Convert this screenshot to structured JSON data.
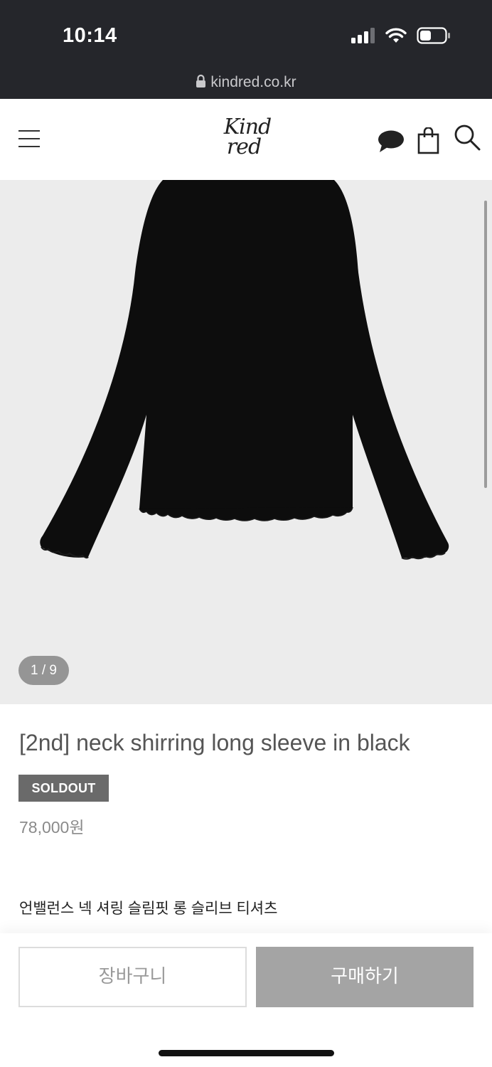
{
  "status_bar": {
    "time": "10:14",
    "icons": [
      "signal-icon",
      "wifi-icon",
      "battery-icon"
    ],
    "url": "kindred.co.kr"
  },
  "header": {
    "logo_line1": "Kind",
    "logo_line2": "red",
    "icons": [
      "menu-icon",
      "chat-icon",
      "shopping-bag-icon",
      "search-icon"
    ]
  },
  "gallery": {
    "counter": "1 / 9",
    "background": "#ececec",
    "garment_color": "#0d0d0d"
  },
  "product": {
    "title": "[2nd] neck shirring long sleeve in black",
    "badge": "SOLDOUT",
    "price": "78,000원",
    "description": "언밸런스 넥 셔링 슬림핏 롱 슬리브 티셔츠"
  },
  "actions": {
    "cart_label": "장바구니",
    "buy_label": "구매하기"
  },
  "colors": {
    "status_bar_bg": "#25262b",
    "badge_bg": "#6a6a6a",
    "buy_button_bg": "#a4a4a4"
  }
}
